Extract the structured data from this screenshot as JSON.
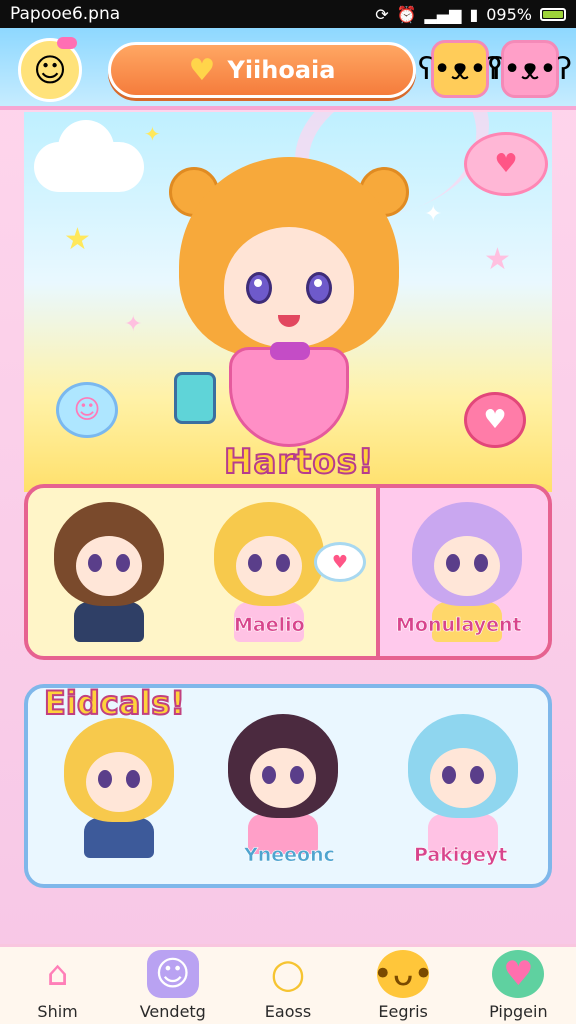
{
  "status_bar": {
    "left_text": "Papooe6.pna",
    "battery_text": "095%",
    "battery_level": 0.9,
    "icons": [
      "sync-icon",
      "alarm-icon",
      "signal-icon",
      "sim-icon",
      "battery-icon"
    ]
  },
  "header": {
    "title": "Yiihoaia",
    "avatar_icon": "avatar-girl-icon",
    "title_icon": "heart-icon",
    "buttons": [
      {
        "icon": "bear-face-icon",
        "color": "#ffcc59"
      },
      {
        "icon": "bear-face-icon",
        "color": "#ff9fc8"
      }
    ]
  },
  "scene": {
    "title": "Hartos!"
  },
  "row_1": {
    "characters": [
      {
        "label": "",
        "hair": "#7a4a2c"
      },
      {
        "label": "Maelio",
        "hair": "#f7c94c"
      },
      {
        "label": "Monulayent",
        "hair": "#c9a7f0"
      }
    ]
  },
  "row_2": {
    "title": "Eidcals!",
    "characters": [
      {
        "label": "",
        "hair": "#f7c94c"
      },
      {
        "label": "Yneeonc",
        "hair": "#4b2a3f"
      },
      {
        "label": "Pakigeyt",
        "hair": "#8fd6ef"
      }
    ]
  },
  "bottom_nav": {
    "items": [
      {
        "label": "Shim",
        "icon": "home-icon"
      },
      {
        "label": "Vendetg",
        "icon": "pet-icon"
      },
      {
        "label": "Eaoss",
        "icon": "ring-icon"
      },
      {
        "label": "Eegris",
        "icon": "bird-icon"
      },
      {
        "label": "Pipgein",
        "icon": "jar-icon"
      }
    ]
  }
}
